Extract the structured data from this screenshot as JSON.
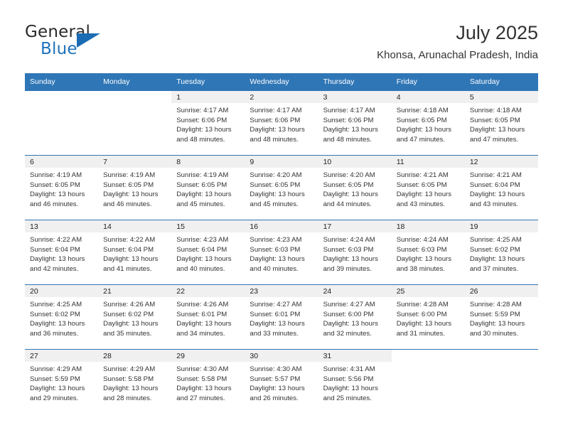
{
  "brand": {
    "line1": "General",
    "line2": "Blue",
    "accent_color": "#1b6cb4",
    "triangle_icon": "brand-triangle-icon"
  },
  "header": {
    "month_title": "July 2025",
    "location": "Khonsa, Arunachal Pradesh, India"
  },
  "theme": {
    "header_bg": "#2f76b6",
    "daynum_band_bg": "#f0f0f0",
    "row_divider": "#2f76b6",
    "text": "#333333"
  },
  "calendar": {
    "weekday_headers": [
      "Sunday",
      "Monday",
      "Tuesday",
      "Wednesday",
      "Thursday",
      "Friday",
      "Saturday"
    ],
    "weeks": [
      [
        {
          "day": "",
          "blank": true,
          "lines": []
        },
        {
          "day": "",
          "blank": true,
          "lines": []
        },
        {
          "day": "1",
          "lines": [
            "Sunrise: 4:17 AM",
            "Sunset: 6:06 PM",
            "Daylight: 13 hours",
            "and 48 minutes."
          ]
        },
        {
          "day": "2",
          "lines": [
            "Sunrise: 4:17 AM",
            "Sunset: 6:06 PM",
            "Daylight: 13 hours",
            "and 48 minutes."
          ]
        },
        {
          "day": "3",
          "lines": [
            "Sunrise: 4:17 AM",
            "Sunset: 6:06 PM",
            "Daylight: 13 hours",
            "and 48 minutes."
          ]
        },
        {
          "day": "4",
          "lines": [
            "Sunrise: 4:18 AM",
            "Sunset: 6:05 PM",
            "Daylight: 13 hours",
            "and 47 minutes."
          ]
        },
        {
          "day": "5",
          "lines": [
            "Sunrise: 4:18 AM",
            "Sunset: 6:05 PM",
            "Daylight: 13 hours",
            "and 47 minutes."
          ]
        }
      ],
      [
        {
          "day": "6",
          "lines": [
            "Sunrise: 4:19 AM",
            "Sunset: 6:05 PM",
            "Daylight: 13 hours",
            "and 46 minutes."
          ]
        },
        {
          "day": "7",
          "lines": [
            "Sunrise: 4:19 AM",
            "Sunset: 6:05 PM",
            "Daylight: 13 hours",
            "and 46 minutes."
          ]
        },
        {
          "day": "8",
          "lines": [
            "Sunrise: 4:19 AM",
            "Sunset: 6:05 PM",
            "Daylight: 13 hours",
            "and 45 minutes."
          ]
        },
        {
          "day": "9",
          "lines": [
            "Sunrise: 4:20 AM",
            "Sunset: 6:05 PM",
            "Daylight: 13 hours",
            "and 45 minutes."
          ]
        },
        {
          "day": "10",
          "lines": [
            "Sunrise: 4:20 AM",
            "Sunset: 6:05 PM",
            "Daylight: 13 hours",
            "and 44 minutes."
          ]
        },
        {
          "day": "11",
          "lines": [
            "Sunrise: 4:21 AM",
            "Sunset: 6:05 PM",
            "Daylight: 13 hours",
            "and 43 minutes."
          ]
        },
        {
          "day": "12",
          "lines": [
            "Sunrise: 4:21 AM",
            "Sunset: 6:04 PM",
            "Daylight: 13 hours",
            "and 43 minutes."
          ]
        }
      ],
      [
        {
          "day": "13",
          "lines": [
            "Sunrise: 4:22 AM",
            "Sunset: 6:04 PM",
            "Daylight: 13 hours",
            "and 42 minutes."
          ]
        },
        {
          "day": "14",
          "lines": [
            "Sunrise: 4:22 AM",
            "Sunset: 6:04 PM",
            "Daylight: 13 hours",
            "and 41 minutes."
          ]
        },
        {
          "day": "15",
          "lines": [
            "Sunrise: 4:23 AM",
            "Sunset: 6:04 PM",
            "Daylight: 13 hours",
            "and 40 minutes."
          ]
        },
        {
          "day": "16",
          "lines": [
            "Sunrise: 4:23 AM",
            "Sunset: 6:03 PM",
            "Daylight: 13 hours",
            "and 40 minutes."
          ]
        },
        {
          "day": "17",
          "lines": [
            "Sunrise: 4:24 AM",
            "Sunset: 6:03 PM",
            "Daylight: 13 hours",
            "and 39 minutes."
          ]
        },
        {
          "day": "18",
          "lines": [
            "Sunrise: 4:24 AM",
            "Sunset: 6:03 PM",
            "Daylight: 13 hours",
            "and 38 minutes."
          ]
        },
        {
          "day": "19",
          "lines": [
            "Sunrise: 4:25 AM",
            "Sunset: 6:02 PM",
            "Daylight: 13 hours",
            "and 37 minutes."
          ]
        }
      ],
      [
        {
          "day": "20",
          "lines": [
            "Sunrise: 4:25 AM",
            "Sunset: 6:02 PM",
            "Daylight: 13 hours",
            "and 36 minutes."
          ]
        },
        {
          "day": "21",
          "lines": [
            "Sunrise: 4:26 AM",
            "Sunset: 6:02 PM",
            "Daylight: 13 hours",
            "and 35 minutes."
          ]
        },
        {
          "day": "22",
          "lines": [
            "Sunrise: 4:26 AM",
            "Sunset: 6:01 PM",
            "Daylight: 13 hours",
            "and 34 minutes."
          ]
        },
        {
          "day": "23",
          "lines": [
            "Sunrise: 4:27 AM",
            "Sunset: 6:01 PM",
            "Daylight: 13 hours",
            "and 33 minutes."
          ]
        },
        {
          "day": "24",
          "lines": [
            "Sunrise: 4:27 AM",
            "Sunset: 6:00 PM",
            "Daylight: 13 hours",
            "and 32 minutes."
          ]
        },
        {
          "day": "25",
          "lines": [
            "Sunrise: 4:28 AM",
            "Sunset: 6:00 PM",
            "Daylight: 13 hours",
            "and 31 minutes."
          ]
        },
        {
          "day": "26",
          "lines": [
            "Sunrise: 4:28 AM",
            "Sunset: 5:59 PM",
            "Daylight: 13 hours",
            "and 30 minutes."
          ]
        }
      ],
      [
        {
          "day": "27",
          "lines": [
            "Sunrise: 4:29 AM",
            "Sunset: 5:59 PM",
            "Daylight: 13 hours",
            "and 29 minutes."
          ]
        },
        {
          "day": "28",
          "lines": [
            "Sunrise: 4:29 AM",
            "Sunset: 5:58 PM",
            "Daylight: 13 hours",
            "and 28 minutes."
          ]
        },
        {
          "day": "29",
          "lines": [
            "Sunrise: 4:30 AM",
            "Sunset: 5:58 PM",
            "Daylight: 13 hours",
            "and 27 minutes."
          ]
        },
        {
          "day": "30",
          "lines": [
            "Sunrise: 4:30 AM",
            "Sunset: 5:57 PM",
            "Daylight: 13 hours",
            "and 26 minutes."
          ]
        },
        {
          "day": "31",
          "lines": [
            "Sunrise: 4:31 AM",
            "Sunset: 5:56 PM",
            "Daylight: 13 hours",
            "and 25 minutes."
          ]
        },
        {
          "day": "",
          "blank": true,
          "lines": []
        },
        {
          "day": "",
          "blank": true,
          "lines": []
        }
      ]
    ]
  }
}
